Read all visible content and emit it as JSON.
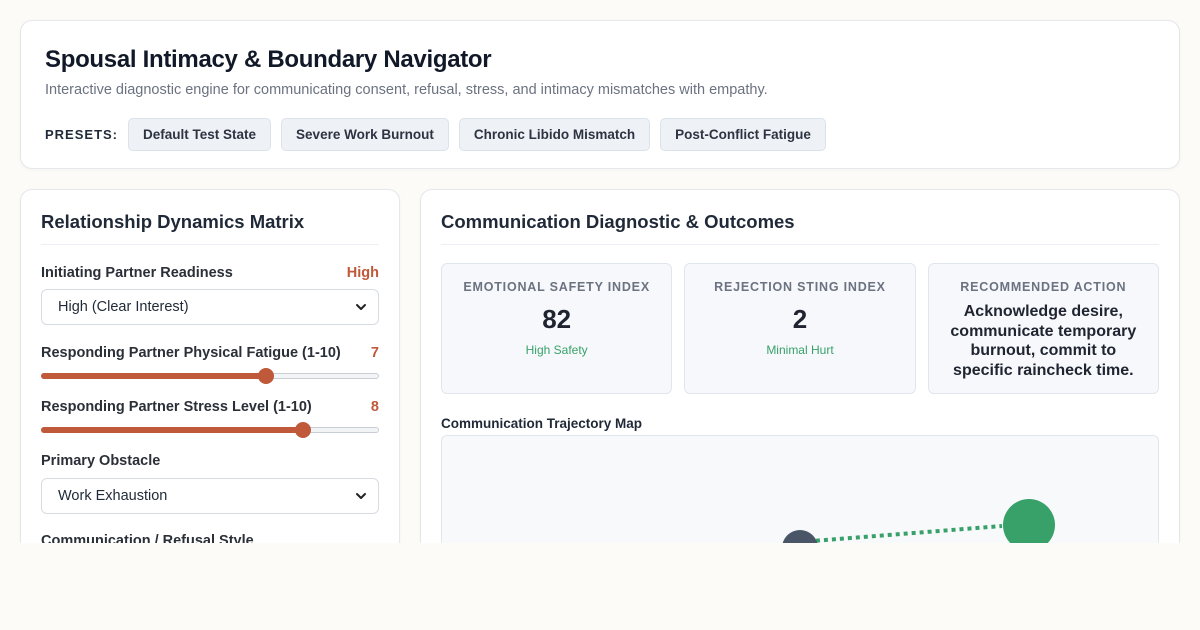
{
  "header": {
    "title": "Spousal Intimacy & Boundary Navigator",
    "subtitle": "Interactive diagnostic engine for communicating consent, refusal, stress, and intimacy mismatches with empathy.",
    "presets_label": "PRESETS:",
    "presets": [
      {
        "label": "Default Test State"
      },
      {
        "label": "Severe Work Burnout"
      },
      {
        "label": "Chronic Libido Mismatch"
      },
      {
        "label": "Post-Conflict Fatigue"
      }
    ]
  },
  "matrix": {
    "title": "Relationship Dynamics Matrix",
    "readiness": {
      "label": "Initiating Partner Readiness",
      "value": "High",
      "selected": "High (Clear Interest)"
    },
    "fatigue": {
      "label": "Responding Partner Physical Fatigue (1-10)",
      "value": "7",
      "min": 1,
      "max": 10,
      "current": 7
    },
    "stress": {
      "label": "Responding Partner Stress Level (1-10)",
      "value": "8",
      "min": 1,
      "max": 10,
      "current": 8
    },
    "obstacle": {
      "label": "Primary Obstacle",
      "selected": "Work Exhaustion"
    },
    "style": {
      "label": "Communication / Refusal Style"
    }
  },
  "diagnostic": {
    "title": "Communication Diagnostic & Outcomes",
    "safety": {
      "label": "EMOTIONAL SAFETY INDEX",
      "value": "82",
      "note": "High Safety"
    },
    "sting": {
      "label": "REJECTION STING INDEX",
      "value": "2",
      "note": "Minimal Hurt"
    },
    "action": {
      "label": "RECOMMENDED ACTION",
      "text": "Acknowledge desire, communicate temporary burnout, commit to specific raincheck time."
    },
    "trajectory": {
      "title": "Communication Trajectory Map"
    }
  },
  "colors": {
    "accent": "#c0583a",
    "positive": "#38a169",
    "node_start": "#4a5568",
    "node_end": "#38a169"
  }
}
